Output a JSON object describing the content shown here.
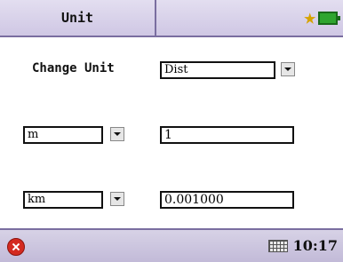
{
  "header": {
    "title": "Unit",
    "star_icon": "star-icon",
    "battery_icon": "battery-icon"
  },
  "form": {
    "change_unit_label": "Change Unit",
    "unit_type_select": {
      "value": "Dist"
    },
    "from_unit_select": {
      "value": "m"
    },
    "from_value": "1",
    "to_unit_select": {
      "value": "km"
    },
    "to_value": "0.001000"
  },
  "taskbar": {
    "close_icon": "close-icon",
    "keyboard_icon": "keyboard-icon",
    "time": "10:17"
  },
  "colors": {
    "titlebar": "#cfc7e4",
    "border": "#7a6ea0",
    "star": "#d6a300",
    "battery": "#2fa52f",
    "close": "#d42a20"
  }
}
